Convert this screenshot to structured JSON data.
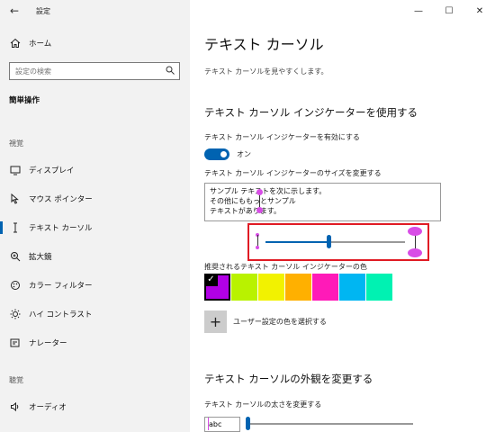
{
  "app": {
    "title": "設定"
  },
  "window_controls": {
    "minimize": "—",
    "maximize": "☐",
    "close": "✕"
  },
  "sidebar": {
    "home": "ホーム",
    "search_placeholder": "設定の検索",
    "section": "簡単操作",
    "group_vision": "視覚",
    "items": [
      {
        "label": "ディスプレイ",
        "icon": "display-icon"
      },
      {
        "label": "マウス ポインター",
        "icon": "mouse-pointer-icon"
      },
      {
        "label": "テキスト カーソル",
        "icon": "text-cursor-icon"
      },
      {
        "label": "拡大鏡",
        "icon": "magnifier-icon"
      },
      {
        "label": "カラー フィルター",
        "icon": "color-filter-icon"
      },
      {
        "label": "ハイ コントラスト",
        "icon": "high-contrast-icon"
      },
      {
        "label": "ナレーター",
        "icon": "narrator-icon"
      }
    ],
    "group_hearing": "聴覚",
    "hearing_items": [
      {
        "label": "オーディオ",
        "icon": "audio-icon"
      }
    ]
  },
  "main": {
    "title": "テキスト カーソル",
    "subtitle": "テキスト カーソルを見やすくします。",
    "indicator_heading": "テキスト カーソル インジケーターを使用する",
    "enable_label": "テキスト カーソル インジケーターを有効にする",
    "toggle_state": "オン",
    "size_label": "テキスト カーソル インジケーターのサイズを変更する",
    "preview_lines": [
      "サンプル テキストを次に示します。",
      "その他にももっとサンプル",
      "テキストがあります。"
    ],
    "size_slider_value": 0.45,
    "color_label": "推奨されるテキスト カーソル インジケーターの色",
    "colors": [
      "#b200e6",
      "#b9f200",
      "#f2f200",
      "#ffb000",
      "#ff1ab8",
      "#00b6f2",
      "#00f2b2"
    ],
    "custom_color_label": "ユーザー設定の色を選択する",
    "custom_color_icon": "+",
    "appearance_heading": "テキスト カーソルの外観を変更する",
    "thickness_label": "テキスト カーソルの太さを変更する",
    "thickness_preview": "abc",
    "thickness_value": 0.0
  }
}
